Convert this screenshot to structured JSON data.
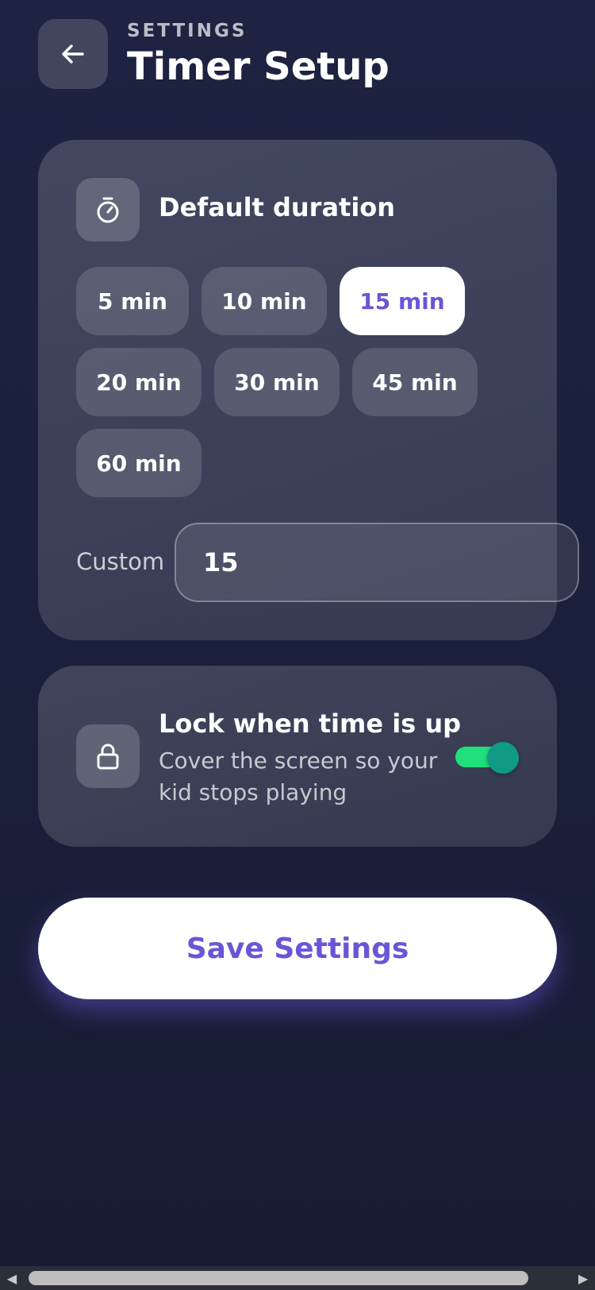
{
  "header": {
    "eyebrow": "SETTINGS",
    "title": "Timer Setup",
    "back_icon": "arrow-left-icon"
  },
  "duration_card": {
    "icon": "stopwatch-icon",
    "title": "Default duration",
    "options": [
      "5 min",
      "10 min",
      "15 min",
      "20 min",
      "30 min",
      "45 min",
      "60 min"
    ],
    "selected": "15 min",
    "custom_label": "Custom",
    "custom_value": "15"
  },
  "lock_card": {
    "icon": "lock-icon",
    "title": "Lock when time is up",
    "description": "Cover the screen so your kid stops playing",
    "enabled": true
  },
  "save_button": {
    "label": "Save Settings"
  },
  "colors": {
    "accent": "#6b55d6",
    "toggle_on": "#1fe07a",
    "background": "#1d2340"
  }
}
